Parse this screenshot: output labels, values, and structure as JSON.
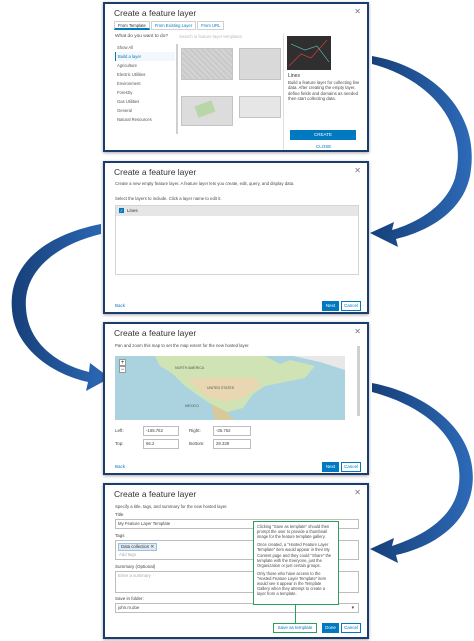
{
  "colors": {
    "arrow": "#1e56a0",
    "accent": "#0079c1",
    "frame": "#1b3d6e"
  },
  "panel1": {
    "title": "Create a feature layer",
    "tabs": [
      "From Template",
      "From Existing Layer",
      "From URL"
    ],
    "question": "What do you want to do?",
    "search_placeholder": "Search in feature layer templates",
    "categories": [
      "Show All",
      "Build a layer",
      "Agriculture",
      "Electric Utilities",
      "Environment",
      "Forestry",
      "Gas Utilities",
      "General",
      "Natural Resources"
    ],
    "selected_category": "Build a layer",
    "detail_title": "Lines",
    "detail_text": "Build a feature layer for collecting line data. After creating the empty layer, define fields and domains as needed then start collecting data.",
    "create_label": "CREATE",
    "close_label": "CLOSE"
  },
  "panel2": {
    "title": "Create a feature layer",
    "desc": "Create a new empty feature layer. A feature layer lets you create, edit, query, and display data.",
    "select_text": "Select the layers to include. Click a layer name to edit it.",
    "layer_name": "Lines",
    "back_label": "Back",
    "next_label": "Next",
    "cancel_label": "Cancel"
  },
  "panel3": {
    "title": "Create a feature layer",
    "desc": "Pan and zoom this map to set the map extent for the new hosted layer.",
    "map_labels": {
      "north_america": "NORTH AMERICA",
      "us": "UNITED STATES",
      "mexico": "MEXICO"
    },
    "zoom_in": "+",
    "zoom_out": "−",
    "left_label": "Left:",
    "left_value": "-165.762",
    "right_label": "Right:",
    "right_value": "-35.762",
    "top_label": "Top:",
    "top_value": "66.2",
    "bottom_label": "Bottom:",
    "bottom_value": "28.339",
    "back_label": "Back",
    "next_label": "Next",
    "cancel_label": "Cancel"
  },
  "panel4": {
    "title": "Create a feature layer",
    "desc": "Specify a title, tags, and summary for the new hosted layer.",
    "title_label": "Title",
    "title_value": "My Feature Layer Template",
    "tags_label": "Tags",
    "tag_chip": "Data collection",
    "tags_placeholder": "Add tags",
    "summary_label": "Summary (Optional)",
    "summary_placeholder": "Enter a summary",
    "folder_label": "Save in folder:",
    "folder_value": "john.m.doe",
    "save_template_label": "Save as template",
    "done_label": "Done",
    "cancel_label": "Cancel",
    "callout_p1": "Clicking \"Save as template\" should then prompt the user to provide a thumbnail image for the feature template gallery.",
    "callout_p2": "Once created, a \"Hosted Feature Layer Template\" item would appear in their My Content page and they could \"Share\" the template with the Everyone, just the Organization or just certain groups.",
    "callout_p3": "Only those who have access to the \"Hosted Feature Layer Template\" item would see it appear in the Template Gallery when they attempt to create a layer from a template."
  }
}
